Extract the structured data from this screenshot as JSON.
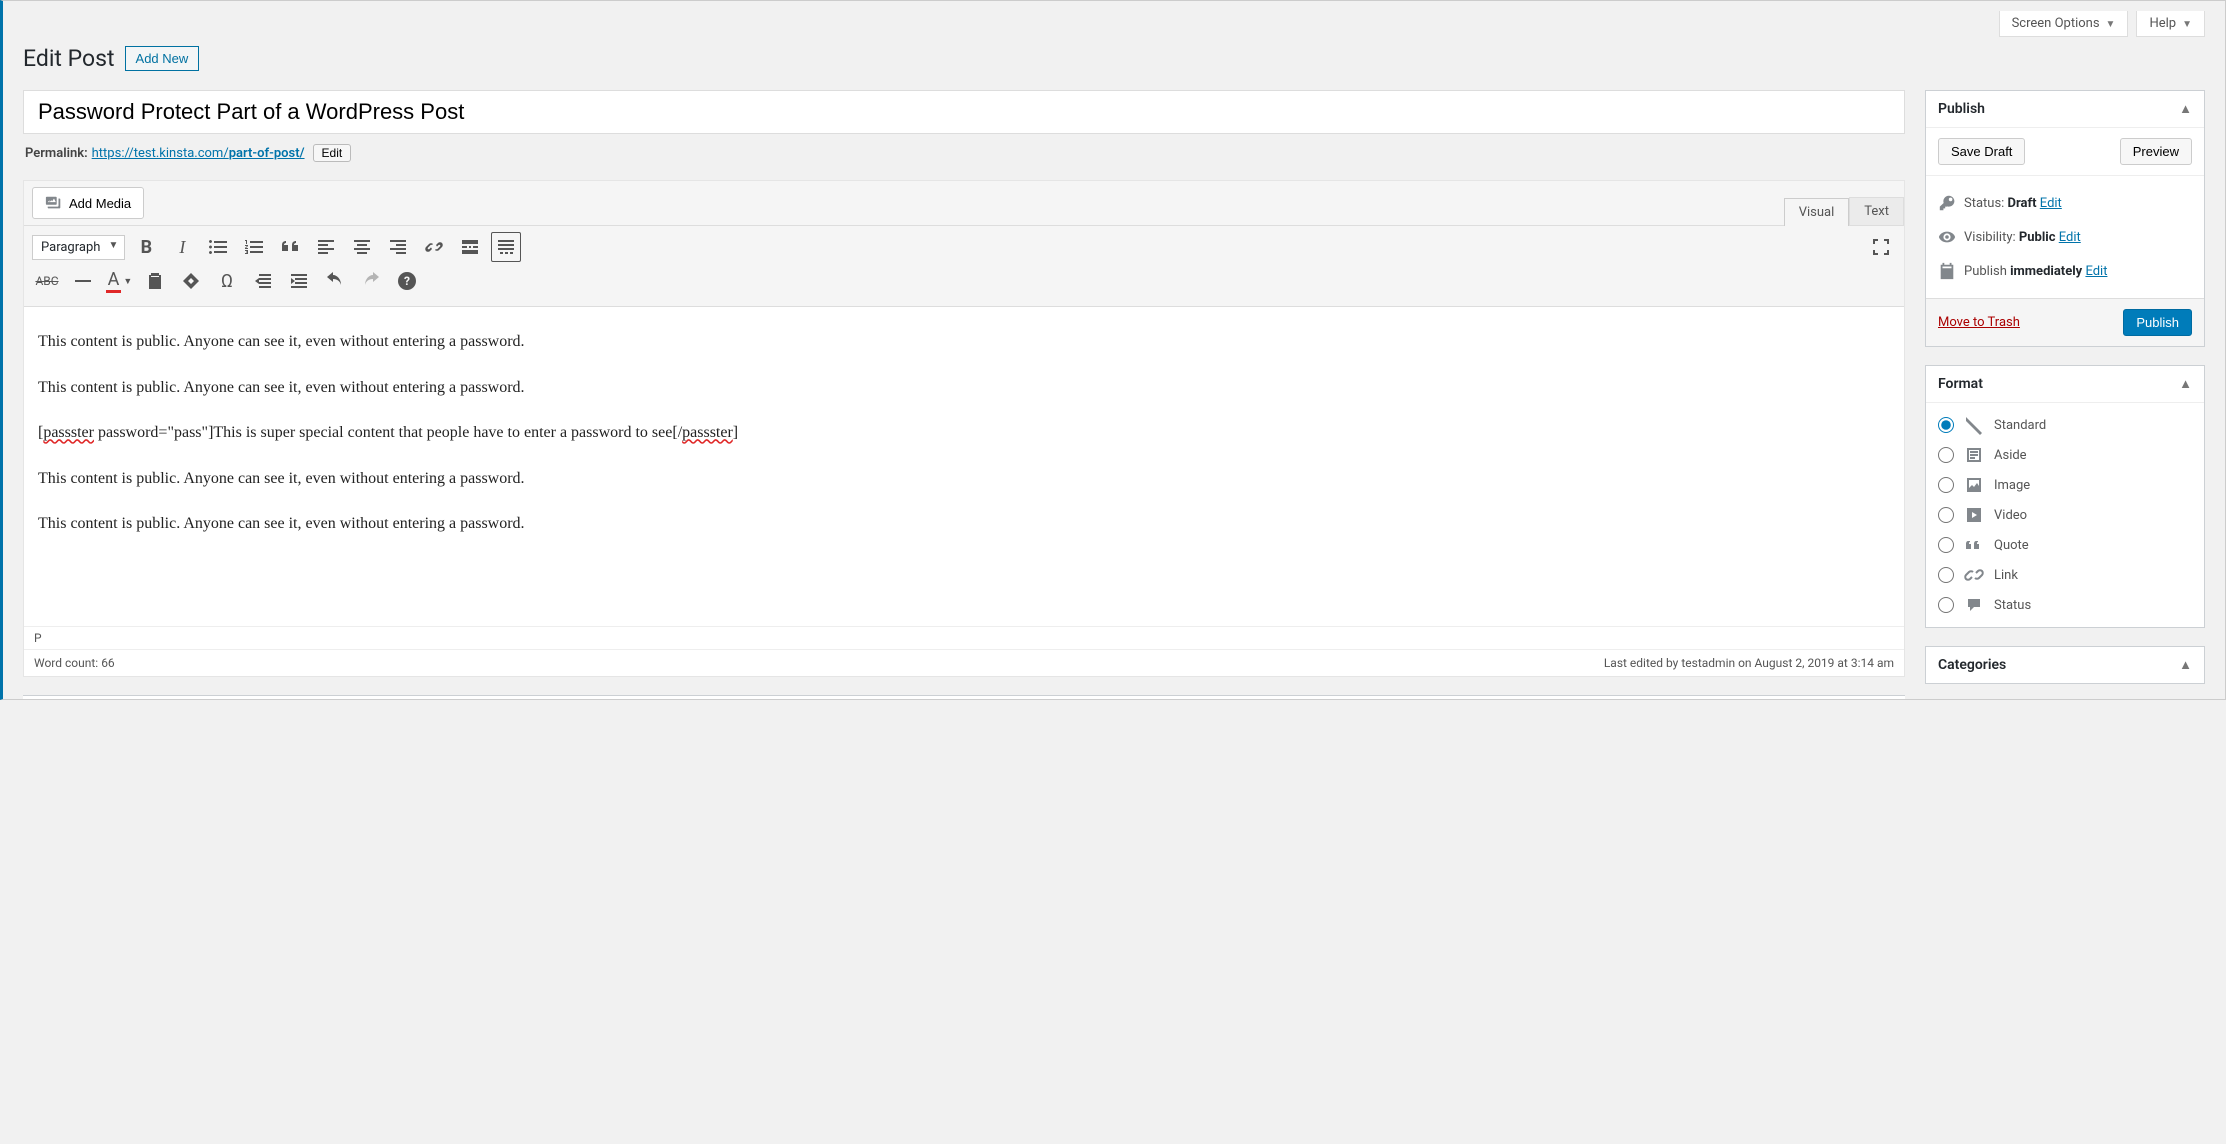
{
  "topright": {
    "screen_options": "Screen Options",
    "help": "Help"
  },
  "header": {
    "title": "Edit Post",
    "add_new": "Add New"
  },
  "post": {
    "title": "Password Protect Part of a WordPress Post",
    "permalink_label": "Permalink:",
    "permalink_base": "https://test.kinsta.com/",
    "permalink_slug": "part-of-post/",
    "edit_btn": "Edit"
  },
  "editor": {
    "add_media": "Add Media",
    "tab_visual": "Visual",
    "tab_text": "Text",
    "format_select": "Paragraph",
    "body": {
      "p1": "This content is public. Anyone can see it, even without entering a password.",
      "p2": "This content is public. Anyone can see it, even without entering a password.",
      "sc_open_err": "passster",
      "sc_open_mid": " password=\"pass\"]This is super special content that people have to enter a password to see[/",
      "sc_close_err": "passster",
      "p4": "This content is public. Anyone can see it, even without entering a password.",
      "p5": "This content is public. Anyone can see it, even without entering a password."
    },
    "path": "P",
    "word_count_label": "Word count: ",
    "word_count": "66",
    "last_edited": "Last edited by testadmin on August 2, 2019 at 3:14 am"
  },
  "publish": {
    "heading": "Publish",
    "save_draft": "Save Draft",
    "preview": "Preview",
    "status_label": "Status: ",
    "status_value": "Draft",
    "visibility_label": "Visibility: ",
    "visibility_value": "Public",
    "publish_label": "Publish ",
    "publish_value": "immediately",
    "edit_link": "Edit",
    "trash": "Move to Trash",
    "publish_btn": "Publish"
  },
  "format": {
    "heading": "Format",
    "items": [
      {
        "label": "Standard",
        "checked": true
      },
      {
        "label": "Aside",
        "checked": false
      },
      {
        "label": "Image",
        "checked": false
      },
      {
        "label": "Video",
        "checked": false
      },
      {
        "label": "Quote",
        "checked": false
      },
      {
        "label": "Link",
        "checked": false
      },
      {
        "label": "Status",
        "checked": false
      }
    ]
  },
  "categories": {
    "heading": "Categories"
  }
}
